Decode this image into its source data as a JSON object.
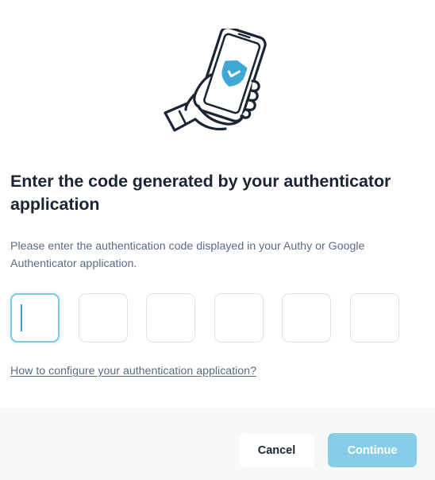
{
  "dialog": {
    "title": "Enter the code generated by your authenticator application",
    "description": "Please enter the authentication code displayed in your Authy or Google Authenticator application.",
    "help_link": "How to configure your authentication application?",
    "code_inputs": [
      "",
      "",
      "",
      "",
      "",
      ""
    ],
    "active_input_index": 0
  },
  "footer": {
    "cancel_label": "Cancel",
    "continue_label": "Continue"
  },
  "colors": {
    "accent": "#87cde8",
    "shield": "#3fa7d6",
    "title": "#1b2533",
    "muted_text": "#5b6b84",
    "footer_bg": "#f7f8fa"
  },
  "icons": {
    "illustration": "hand-holding-phone-shield-illustration",
    "shield": "shield-check-icon"
  }
}
